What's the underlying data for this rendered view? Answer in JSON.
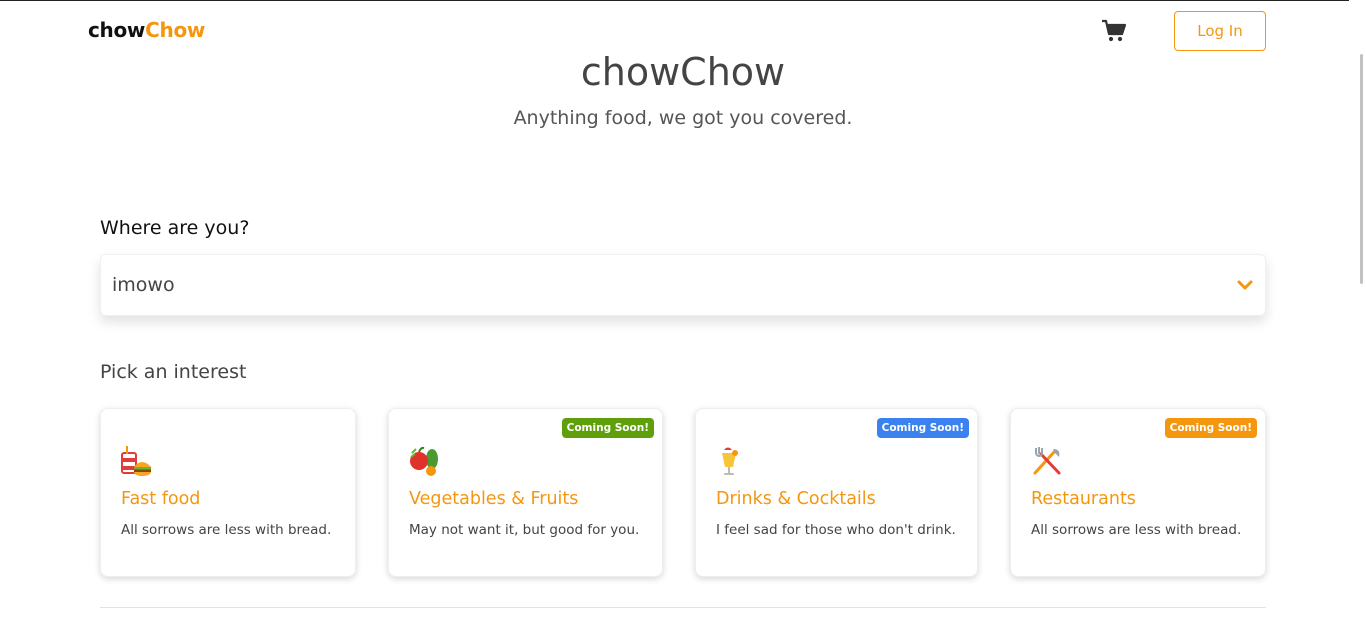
{
  "header": {
    "logo_part1": "chow",
    "logo_part2": "Chow",
    "login_label": "Log In",
    "cart_icon": "cart-icon"
  },
  "hero": {
    "title": "chowChow",
    "subtitle": "Anything food, we got you covered."
  },
  "location": {
    "label": "Where are you?",
    "value": "imowo"
  },
  "interests": {
    "label": "Pick an interest",
    "cards": [
      {
        "title": "Fast food",
        "desc": "All sorrows are less with bread.",
        "badge": "",
        "icon": "fast-food-icon"
      },
      {
        "title": "Vegetables & Fruits",
        "desc": "May not want it, but good for you.",
        "badge": "Coming Soon!",
        "badge_color": "#5fa00a",
        "icon": "vegetables-icon"
      },
      {
        "title": "Drinks & Cocktails",
        "desc": "I feel sad for those who don't drink.",
        "badge": "Coming Soon!",
        "badge_color": "#3b82f0",
        "icon": "cocktail-icon"
      },
      {
        "title": "Restaurants",
        "desc": "All sorrows are less with bread.",
        "badge": "Coming Soon!",
        "badge_color": "#f5960f",
        "icon": "utensils-icon"
      }
    ]
  },
  "colors": {
    "accent": "#f5960f"
  }
}
